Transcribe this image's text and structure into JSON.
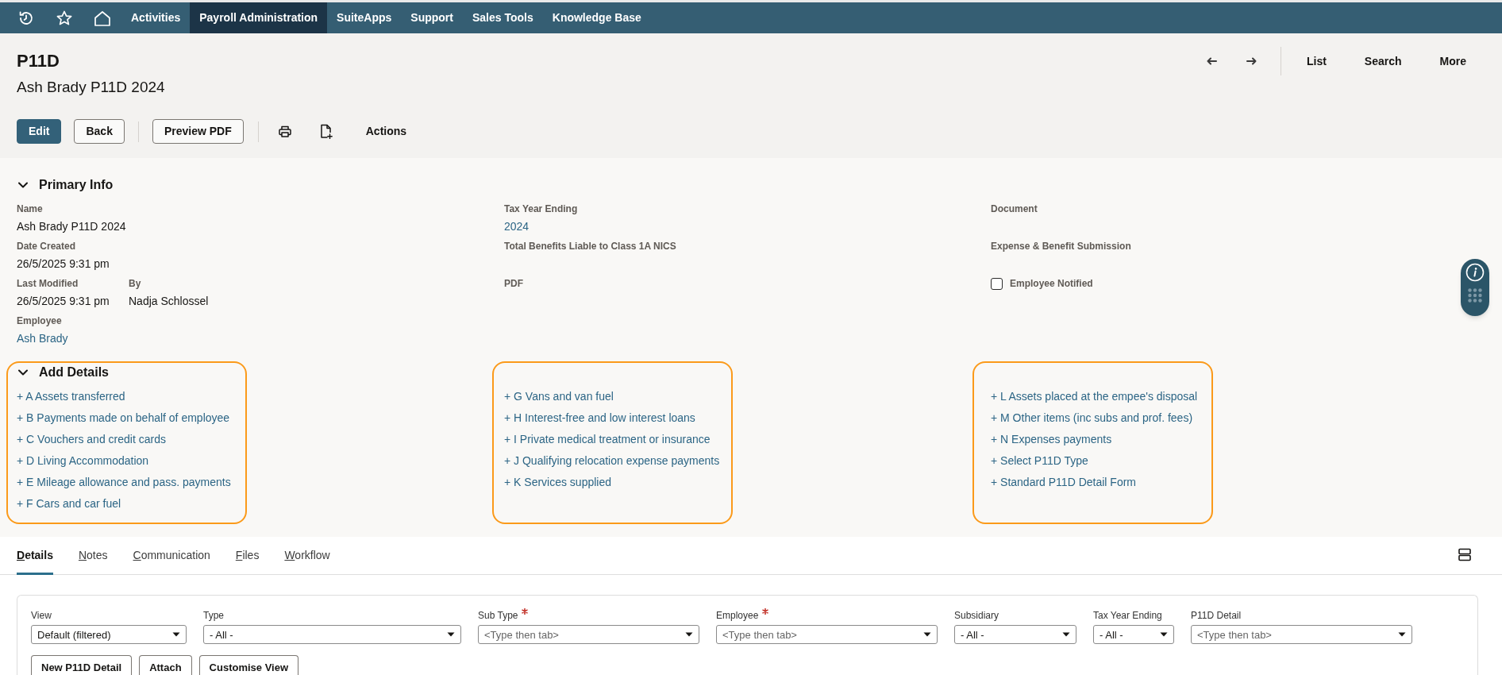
{
  "top_nav": {
    "tabs": [
      {
        "label": "Activities",
        "selected": false
      },
      {
        "label": "Payroll Administration",
        "selected": true
      },
      {
        "label": "SuiteApps",
        "selected": false
      },
      {
        "label": "Support",
        "selected": false
      },
      {
        "label": "Sales Tools",
        "selected": false
      },
      {
        "label": "Knowledge Base",
        "selected": false
      }
    ]
  },
  "record_header": {
    "title": "P11D",
    "subtitle": "Ash Brady P11D 2024",
    "buttons": [
      {
        "label": "Edit",
        "kind": "primary"
      },
      {
        "label": "Back",
        "kind": "secondary"
      },
      {
        "label": "Preview PDF",
        "kind": "secondary"
      }
    ],
    "actions_label": "Actions",
    "page_links": [
      "List",
      "Search",
      "More"
    ]
  },
  "primary_info": {
    "title": "Primary Info",
    "expanded": true,
    "columns": [
      {
        "rows": [
          [
            {
              "label": "Name",
              "value": "Ash Brady P11D 2024",
              "kind": "text"
            }
          ],
          [
            {
              "label": "Date Created",
              "value": "26/5/2025 9:31 pm",
              "kind": "text"
            }
          ],
          [
            {
              "label": "Last Modified",
              "value": "26/5/2025 9:31 pm",
              "kind": "text"
            },
            {
              "label": "By",
              "value": "Nadja Schlossel",
              "kind": "text"
            }
          ],
          [
            {
              "label": "Employee",
              "value": "Ash Brady",
              "kind": "link"
            }
          ]
        ]
      },
      {
        "rows": [
          [
            {
              "label": "Tax Year Ending",
              "value": "2024",
              "kind": "link"
            }
          ],
          [
            {
              "label": "Total Benefits Liable to Class 1A NICS",
              "kind": "text"
            }
          ],
          [
            {
              "label": "PDF",
              "kind": "text"
            }
          ]
        ]
      },
      {
        "rows": [
          [
            {
              "label": "Document",
              "kind": "text"
            }
          ],
          [
            {
              "label": "Expense & Benefit Submission",
              "kind": "text"
            }
          ],
          [
            {
              "label": "Employee Notified",
              "kind": "checkbox",
              "checked": false
            }
          ]
        ]
      }
    ]
  },
  "add_details": {
    "title": "Add Details",
    "expanded": true,
    "groups": [
      {
        "links": [
          "+ A Assets transferred",
          "+ B Payments made on behalf of employee",
          "+ C Vouchers and credit cards",
          "+ D Living Accommodation",
          "+ E Mileage allowance and pass. payments",
          "+ F Cars and car fuel"
        ]
      },
      {
        "links": [
          "+ G Vans and van fuel",
          "+ H Interest-free and low interest loans",
          "+ I Private medical treatment or insurance",
          "+ J Qualifying relocation expense payments",
          "+ K Services supplied"
        ]
      },
      {
        "links": [
          "+ L Assets placed at the empee's disposal",
          "+ M Other items (inc subs and prof. fees)",
          "+ N Expenses payments",
          "+ Select P11D Type",
          "+ Standard P11D Detail Form"
        ]
      }
    ]
  },
  "subtabs": [
    {
      "label": "Details",
      "selected": true
    },
    {
      "label": "Notes",
      "selected": false
    },
    {
      "label": "Communication",
      "selected": false
    },
    {
      "label": "Files",
      "selected": false
    },
    {
      "label": "Workflow",
      "selected": false
    }
  ],
  "filters": [
    {
      "label": "View",
      "value": "Default (filtered)",
      "required": false
    },
    {
      "label": "Type",
      "value": "- All -",
      "required": false
    },
    {
      "label": "Sub Type",
      "placeholder": "<Type then tab>",
      "required": true
    },
    {
      "label": "Employee",
      "placeholder": "<Type then tab>",
      "required": true
    },
    {
      "label": "Subsidiary",
      "value": "- All -",
      "required": false
    },
    {
      "label": "Tax Year Ending",
      "value": "- All -",
      "required": false
    },
    {
      "label": "P11D Detail",
      "placeholder": "<Type then tab>",
      "required": false
    }
  ],
  "list_buttons": [
    "New P11D Detail",
    "Attach",
    "Customise View"
  ]
}
